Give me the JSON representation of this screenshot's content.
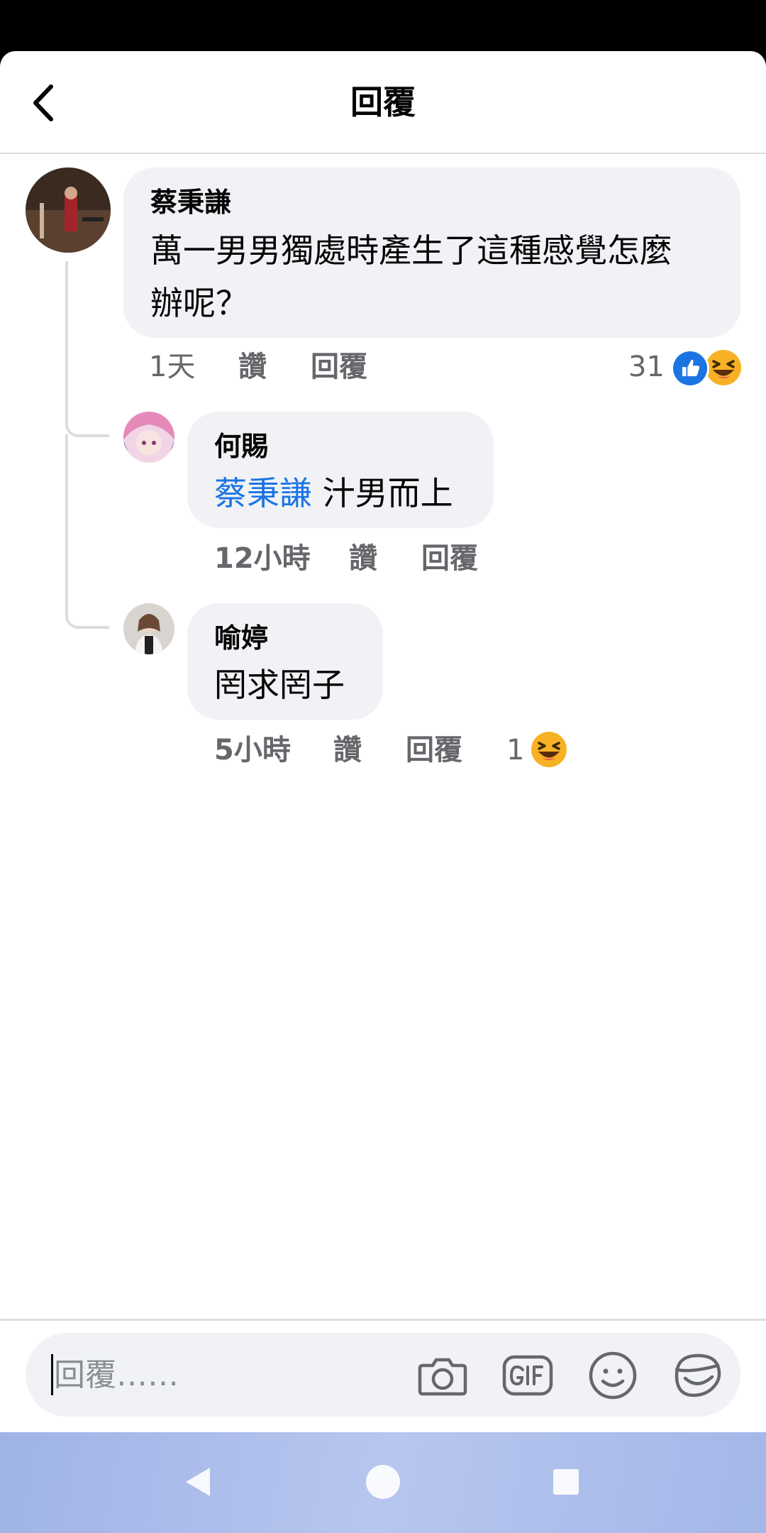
{
  "header": {
    "title": "回覆",
    "back_icon": "chevron-left-icon"
  },
  "comments": [
    {
      "author": "蔡秉謙",
      "body_line1": "萬一男男獨處時產生了這種感覺怎麼",
      "body_line2": "辦呢？",
      "time": "1天",
      "like_label": "讚",
      "reply_label": "回覆",
      "reaction_count": "31",
      "reactions": [
        "like-icon",
        "laughing-emoji-icon"
      ]
    },
    {
      "author": "何賜",
      "mention": "蔡秉謙",
      "body": "汁男而上",
      "time": "12小時",
      "like_label": "讚",
      "reply_label": "回覆"
    },
    {
      "author": "喻婷",
      "body": "罔求罔子",
      "time": "5小時",
      "like_label": "讚",
      "reply_label": "回覆",
      "reaction_count": "1",
      "reactions": [
        "laughing-emoji-icon"
      ]
    }
  ],
  "composer": {
    "placeholder": "回覆……",
    "tools": [
      "camera-icon",
      "gif-icon",
      "emoji-icon",
      "sticker-icon"
    ]
  },
  "colors": {
    "like_blue": "#1b74e4",
    "bubble_bg": "#f0f2f5",
    "meta_gray": "#65676b"
  }
}
